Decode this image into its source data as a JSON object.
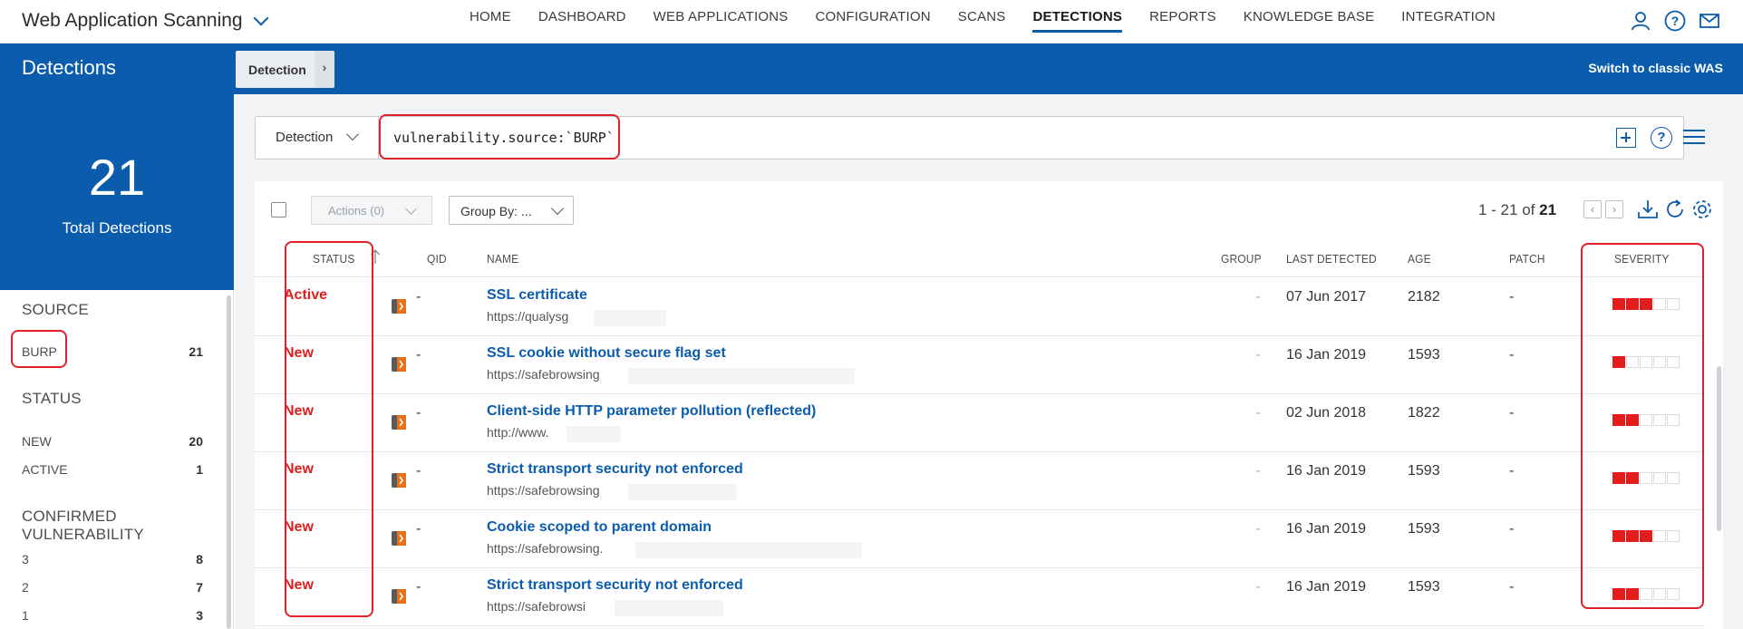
{
  "app": {
    "title": "Web Application Scanning",
    "nav": [
      "HOME",
      "DASHBOARD",
      "WEB APPLICATIONS",
      "CONFIGURATION",
      "SCANS",
      "DETECTIONS",
      "REPORTS",
      "KNOWLEDGE BASE",
      "INTEGRATION"
    ],
    "active_nav": "DETECTIONS",
    "icons": [
      "user-icon",
      "help-icon",
      "mail-icon"
    ]
  },
  "band": {
    "title": "Detections",
    "tab_label": "Detection",
    "switch_link": "Switch to classic WAS"
  },
  "summary": {
    "total": "21",
    "total_label": "Total Detections"
  },
  "filters": {
    "source_title": "SOURCE",
    "source_items": [
      {
        "label": "BURP",
        "count": "21"
      }
    ],
    "status_title": "STATUS",
    "status_items": [
      {
        "label": "NEW",
        "count": "20"
      },
      {
        "label": "ACTIVE",
        "count": "1"
      }
    ],
    "confirmed_title": "CONFIRMED VULNERABILITY",
    "confirmed_items": [
      {
        "label": "3",
        "count": "8"
      },
      {
        "label": "2",
        "count": "7"
      },
      {
        "label": "1",
        "count": "3"
      }
    ]
  },
  "search": {
    "type_label": "Detection",
    "query": "vulnerability.source:`BURP`"
  },
  "toolbar": {
    "actions_label": "Actions (0)",
    "group_by_label": "Group By: ...",
    "pager_prefix": "1 - 21 of",
    "pager_total": "21"
  },
  "columns": [
    "STATUS",
    "QID",
    "NAME",
    "GROUP",
    "LAST DETECTED",
    "AGE",
    "PATCH",
    "SEVERITY"
  ],
  "rows": [
    {
      "status": "Active",
      "qid": "-",
      "name": "SSL certificate",
      "url": "https://qualysg",
      "group": "-",
      "last_detected": "07 Jun 2017",
      "age": "2182",
      "patch": "-",
      "severity": 3
    },
    {
      "status": "New",
      "qid": "-",
      "name": "SSL cookie without secure flag set",
      "url": "https://safebrowsing",
      "group": "-",
      "last_detected": "16 Jan 2019",
      "age": "1593",
      "patch": "-",
      "severity": 1
    },
    {
      "status": "New",
      "qid": "-",
      "name": "Client-side HTTP parameter pollution (reflected)",
      "url": "http://www.",
      "group": "-",
      "last_detected": "02 Jun 2018",
      "age": "1822",
      "patch": "-",
      "severity": 2
    },
    {
      "status": "New",
      "qid": "-",
      "name": "Strict transport security not enforced",
      "url": "https://safebrowsing",
      "group": "-",
      "last_detected": "16 Jan 2019",
      "age": "1593",
      "patch": "-",
      "severity": 2
    },
    {
      "status": "New",
      "qid": "-",
      "name": "Cookie scoped to parent domain",
      "url": "https://safebrowsing.",
      "group": "-",
      "last_detected": "16 Jan 2019",
      "age": "1593",
      "patch": "-",
      "severity": 3
    },
    {
      "status": "New",
      "qid": "-",
      "name": "Strict transport security not enforced",
      "url": "https://safebrowsi",
      "group": "-",
      "last_detected": "16 Jan 2019",
      "age": "1593",
      "patch": "-",
      "severity": 2
    }
  ],
  "colors": {
    "brand": "#0b5cad",
    "status_red": "#e21d1d",
    "highlight": "#e0202a"
  }
}
